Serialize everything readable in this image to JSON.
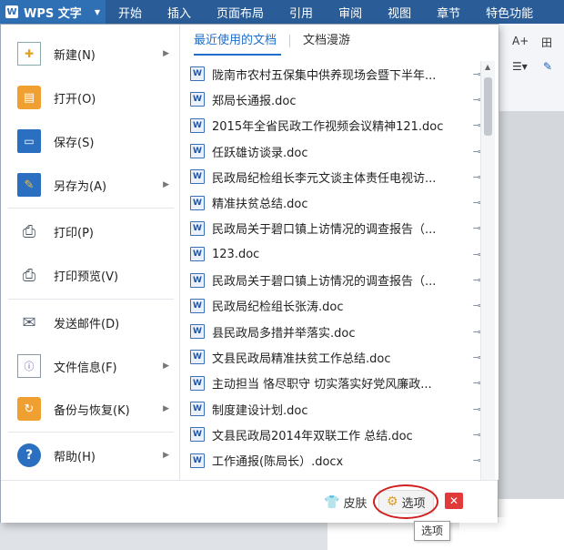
{
  "titlebar": {
    "app_name": "WPS 文字",
    "logo_letter": "W",
    "tabs": [
      "开始",
      "插入",
      "页面布局",
      "引用",
      "审阅",
      "视图",
      "章节",
      "特色功能"
    ]
  },
  "menu": {
    "items": [
      {
        "label": "新建(N)",
        "icon": "new-doc-icon",
        "has_submenu": true
      },
      {
        "label": "打开(O)",
        "icon": "open-folder-icon",
        "has_submenu": false
      },
      {
        "label": "保存(S)",
        "icon": "save-icon",
        "has_submenu": false
      },
      {
        "label": "另存为(A)",
        "icon": "save-as-icon",
        "has_submenu": true
      },
      {
        "label": "打印(P)",
        "icon": "print-icon",
        "has_submenu": false
      },
      {
        "label": "打印预览(V)",
        "icon": "print-preview-icon",
        "has_submenu": false
      },
      {
        "label": "发送邮件(D)",
        "icon": "mail-icon",
        "has_submenu": false
      },
      {
        "label": "文件信息(F)",
        "icon": "file-info-icon",
        "has_submenu": true
      },
      {
        "label": "备份与恢复(K)",
        "icon": "backup-icon",
        "has_submenu": true
      },
      {
        "label": "帮助(H)",
        "icon": "help-icon",
        "has_submenu": true
      }
    ]
  },
  "recent": {
    "tabs": [
      "最近使用的文档",
      "文档漫游"
    ],
    "active_tab": "最近使用的文档",
    "files": [
      "陇南市农村五保集中供养现场会暨下半年...",
      "郑局长通报.doc",
      "2015年全省民政工作视频会议精神121.doc",
      "任跃雄访谈录.doc",
      "民政局纪检组长李元文谈主体责任电视访...",
      "精准扶贫总结.doc",
      "民政局关于碧口镇上访情况的调查报告（...",
      "123.doc",
      "民政局关于碧口镇上访情况的调查报告（...",
      "民政局纪检组长张涛.doc",
      "县民政局多措并举落实.doc",
      "文县民政局精准扶贫工作总结.doc",
      "主动担当 恪尽职守 切实落实好党风廉政...",
      "制度建设计划.doc",
      "文县民政局2014年双联工作 总结.doc",
      "工作通报(陈局长）.docx"
    ]
  },
  "bottom": {
    "skin_label": "皮肤",
    "options_label": "选项",
    "tooltip": "选项"
  },
  "ribbon": {
    "font_size_glyph": "A+",
    "table_glyph": "田"
  },
  "colors": {
    "titlebar": "#2a5d97",
    "accent": "#1e6fc8",
    "highlight_circle": "#d01f1f"
  }
}
